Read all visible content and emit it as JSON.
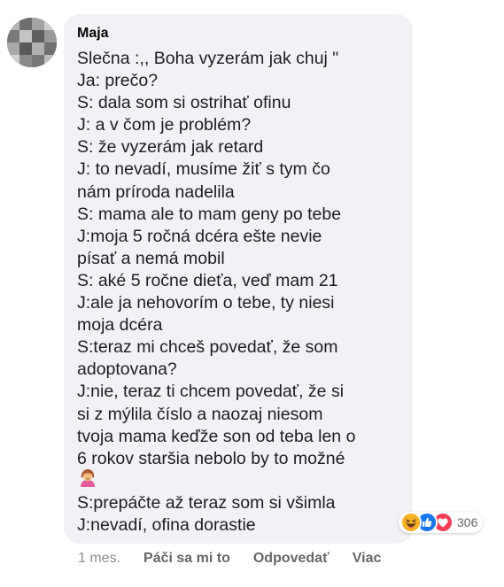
{
  "comment": {
    "author": "Maja",
    "lines": [
      "Slečna :,, Boha vyzerám jak chuj \"",
      "Ja: prečo?",
      "S: dala som si ostrihať ofinu",
      "J: a v čom je problém?",
      "S: že vyzerám jak retard",
      "J: to nevadí, musíme žiť s tym čo",
      "nám príroda nadelila",
      "S: mama ale to mam geny po tebe",
      "J:moja 5 ročná dcéra ešte nevie",
      "písať a nemá mobil",
      "S: aké 5 ročne dieťa, veď mam 21",
      "J:ale ja nehovorím o tebe, ty niesi",
      "moja dcéra",
      "S:teraz mi chceš povedať, že som",
      "adoptovana?",
      "J:nie, teraz ti chcem povedať, že si",
      "si z mýlila číslo a naozaj niesom",
      "tvoja mama keďže son od teba len o",
      "6 rokov staršia nebolo by to možné"
    ],
    "emoji": "facepalm-woman-emoji",
    "lines_after": [
      "S:prepáčte až teraz som si všimla",
      "J:nevadí, ofina dorastie"
    ]
  },
  "reactions": {
    "icons": [
      "haha-reaction-icon",
      "like-reaction-icon",
      "love-reaction-icon"
    ],
    "count": "306"
  },
  "footer": {
    "time": "1 mes.",
    "like": "Páči sa mi to",
    "reply": "Odpovedať",
    "more": "Viac"
  },
  "colors": {
    "bubble": "#f0f2f5",
    "text": "#1c1e21",
    "meta": "#65676b",
    "like_blue": "#1877f2",
    "love_red": "#f33e58",
    "haha_yellow": "#f7b125"
  }
}
